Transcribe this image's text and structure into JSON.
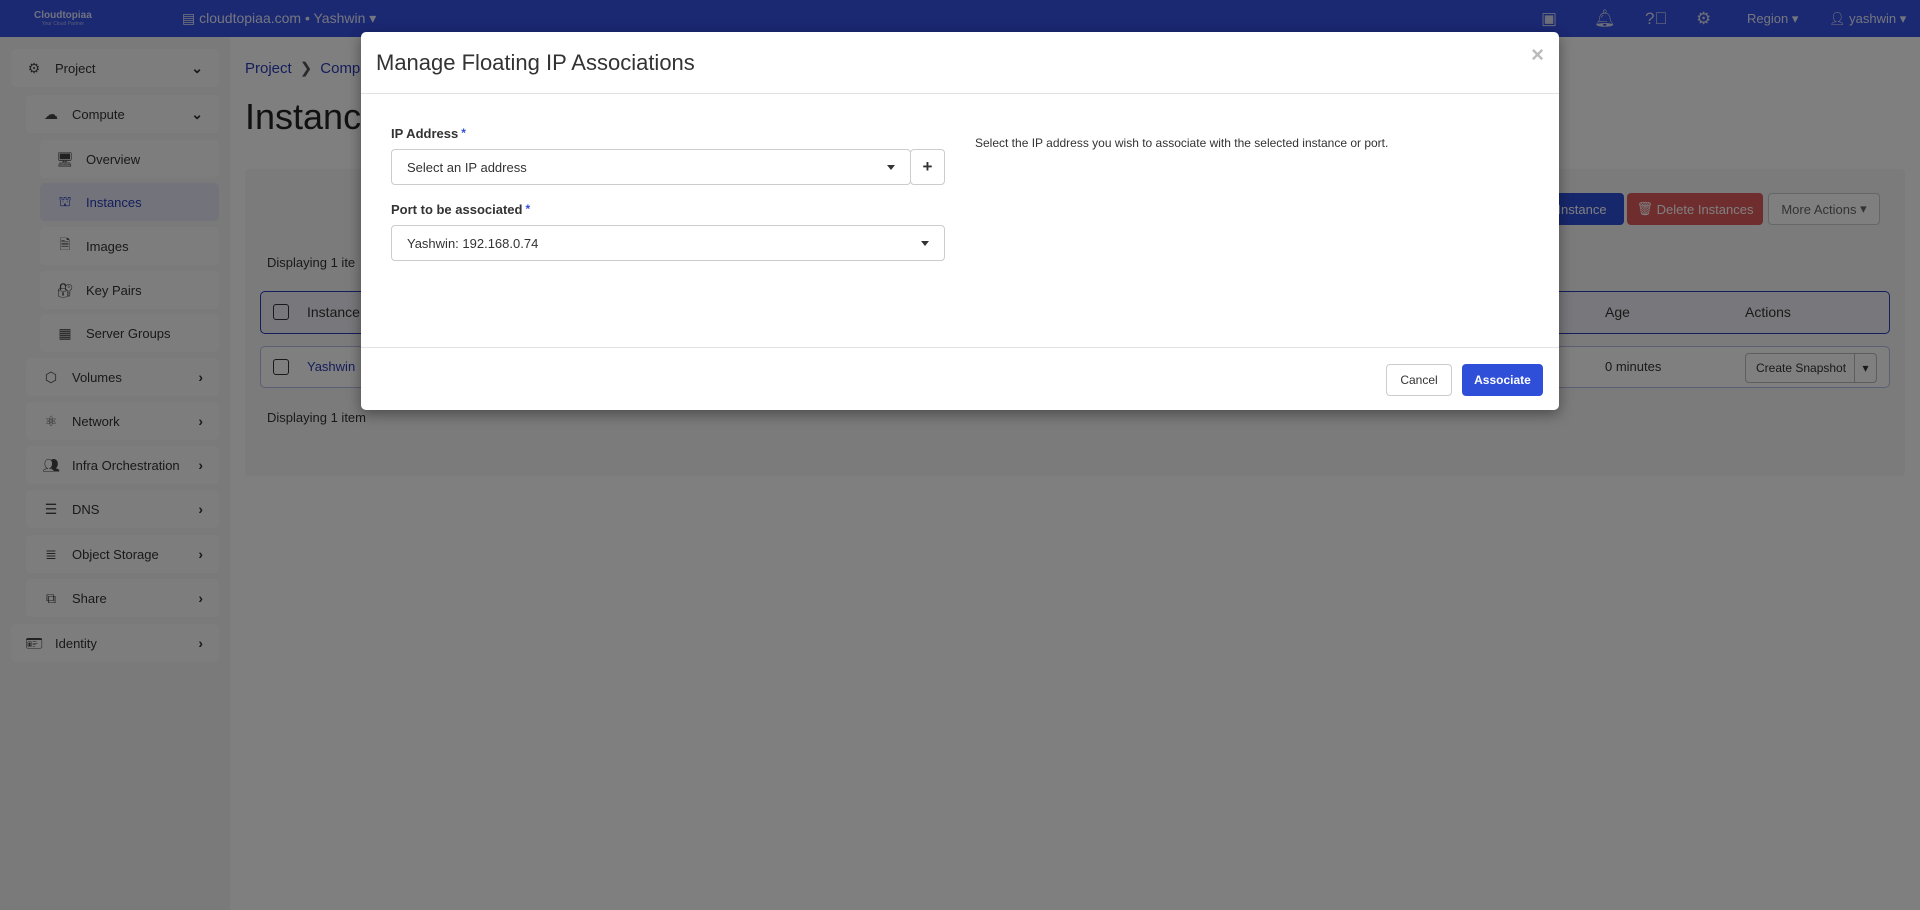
{
  "topbar": {
    "logo": "Cloudtopiaa",
    "logo_tagline": "Your Cloud Partner",
    "project": "cloudtopiaa.com • Yashwin",
    "region": "Region",
    "user": "yashwin",
    "brand_color": "#3650e4"
  },
  "sidebar": {
    "items": [
      {
        "label": "Project",
        "icon": "project-gear-icon",
        "level": 0,
        "chevron": "down"
      },
      {
        "label": "Compute",
        "icon": "cloud-icon",
        "level": 1,
        "chevron": "down"
      },
      {
        "label": "Overview",
        "icon": "monitor-icon",
        "level": 2
      },
      {
        "label": "Instances",
        "icon": "instance-icon",
        "level": 2,
        "active": true
      },
      {
        "label": "Images",
        "icon": "document-icon",
        "level": 2
      },
      {
        "label": "Key Pairs",
        "icon": "key-lock-icon",
        "level": 2
      },
      {
        "label": "Server Groups",
        "icon": "server-group-icon",
        "level": 2
      },
      {
        "label": "Volumes",
        "icon": "volume-box-icon",
        "level": 1,
        "chevron": "right"
      },
      {
        "label": "Network",
        "icon": "network-icon",
        "level": 1,
        "chevron": "right"
      },
      {
        "label": "Infra Orchestration",
        "icon": "orchestration-icon",
        "level": 1,
        "chevron": "right"
      },
      {
        "label": "DNS",
        "icon": "dns-icon",
        "level": 1,
        "chevron": "right"
      },
      {
        "label": "Object Storage",
        "icon": "storage-icon",
        "level": 1,
        "chevron": "right"
      },
      {
        "label": "Share",
        "icon": "share-icon",
        "level": 1,
        "chevron": "right"
      },
      {
        "label": "Identity",
        "icon": "identity-icon",
        "level": 0,
        "chevron": "right"
      }
    ]
  },
  "page": {
    "breadcrumb": [
      "Project",
      "Comp"
    ],
    "title": "Instance",
    "buttons": {
      "launch": "Instance",
      "delete": "Delete Instances",
      "more": "More Actions"
    },
    "displaying": "Displaying 1 item",
    "displaying_top": "Displaying 1 ite",
    "table": {
      "headers": {
        "name": "Instance",
        "age": "Age",
        "actions": "Actions"
      },
      "row": {
        "name": "Yashwin",
        "age": "0 minutes",
        "action": "Create Snapshot"
      }
    }
  },
  "modal": {
    "title": "Manage Floating IP Associations",
    "ip_label": "IP Address",
    "ip_placeholder": "Select an IP address",
    "port_label": "Port to be associated",
    "port_value": "Yashwin: 192.168.0.74",
    "required_mark": "*",
    "help": "Select the IP address you wish to associate with the selected instance or port.",
    "cancel": "Cancel",
    "associate": "Associate",
    "accent": "#2f4fd8"
  }
}
